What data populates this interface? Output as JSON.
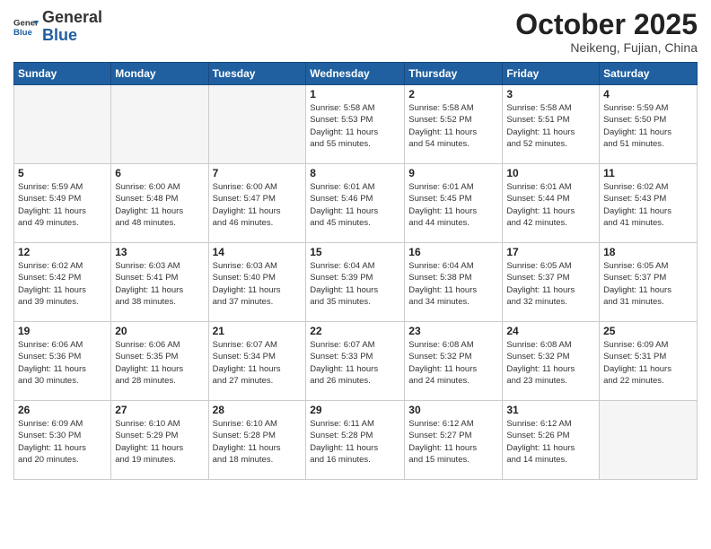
{
  "header": {
    "logo_general": "General",
    "logo_blue": "Blue",
    "month_title": "October 2025",
    "location": "Neikeng, Fujian, China"
  },
  "days_of_week": [
    "Sunday",
    "Monday",
    "Tuesday",
    "Wednesday",
    "Thursday",
    "Friday",
    "Saturday"
  ],
  "weeks": [
    [
      {
        "num": "",
        "info": ""
      },
      {
        "num": "",
        "info": ""
      },
      {
        "num": "",
        "info": ""
      },
      {
        "num": "1",
        "info": "Sunrise: 5:58 AM\nSunset: 5:53 PM\nDaylight: 11 hours\nand 55 minutes."
      },
      {
        "num": "2",
        "info": "Sunrise: 5:58 AM\nSunset: 5:52 PM\nDaylight: 11 hours\nand 54 minutes."
      },
      {
        "num": "3",
        "info": "Sunrise: 5:58 AM\nSunset: 5:51 PM\nDaylight: 11 hours\nand 52 minutes."
      },
      {
        "num": "4",
        "info": "Sunrise: 5:59 AM\nSunset: 5:50 PM\nDaylight: 11 hours\nand 51 minutes."
      }
    ],
    [
      {
        "num": "5",
        "info": "Sunrise: 5:59 AM\nSunset: 5:49 PM\nDaylight: 11 hours\nand 49 minutes."
      },
      {
        "num": "6",
        "info": "Sunrise: 6:00 AM\nSunset: 5:48 PM\nDaylight: 11 hours\nand 48 minutes."
      },
      {
        "num": "7",
        "info": "Sunrise: 6:00 AM\nSunset: 5:47 PM\nDaylight: 11 hours\nand 46 minutes."
      },
      {
        "num": "8",
        "info": "Sunrise: 6:01 AM\nSunset: 5:46 PM\nDaylight: 11 hours\nand 45 minutes."
      },
      {
        "num": "9",
        "info": "Sunrise: 6:01 AM\nSunset: 5:45 PM\nDaylight: 11 hours\nand 44 minutes."
      },
      {
        "num": "10",
        "info": "Sunrise: 6:01 AM\nSunset: 5:44 PM\nDaylight: 11 hours\nand 42 minutes."
      },
      {
        "num": "11",
        "info": "Sunrise: 6:02 AM\nSunset: 5:43 PM\nDaylight: 11 hours\nand 41 minutes."
      }
    ],
    [
      {
        "num": "12",
        "info": "Sunrise: 6:02 AM\nSunset: 5:42 PM\nDaylight: 11 hours\nand 39 minutes."
      },
      {
        "num": "13",
        "info": "Sunrise: 6:03 AM\nSunset: 5:41 PM\nDaylight: 11 hours\nand 38 minutes."
      },
      {
        "num": "14",
        "info": "Sunrise: 6:03 AM\nSunset: 5:40 PM\nDaylight: 11 hours\nand 37 minutes."
      },
      {
        "num": "15",
        "info": "Sunrise: 6:04 AM\nSunset: 5:39 PM\nDaylight: 11 hours\nand 35 minutes."
      },
      {
        "num": "16",
        "info": "Sunrise: 6:04 AM\nSunset: 5:38 PM\nDaylight: 11 hours\nand 34 minutes."
      },
      {
        "num": "17",
        "info": "Sunrise: 6:05 AM\nSunset: 5:37 PM\nDaylight: 11 hours\nand 32 minutes."
      },
      {
        "num": "18",
        "info": "Sunrise: 6:05 AM\nSunset: 5:37 PM\nDaylight: 11 hours\nand 31 minutes."
      }
    ],
    [
      {
        "num": "19",
        "info": "Sunrise: 6:06 AM\nSunset: 5:36 PM\nDaylight: 11 hours\nand 30 minutes."
      },
      {
        "num": "20",
        "info": "Sunrise: 6:06 AM\nSunset: 5:35 PM\nDaylight: 11 hours\nand 28 minutes."
      },
      {
        "num": "21",
        "info": "Sunrise: 6:07 AM\nSunset: 5:34 PM\nDaylight: 11 hours\nand 27 minutes."
      },
      {
        "num": "22",
        "info": "Sunrise: 6:07 AM\nSunset: 5:33 PM\nDaylight: 11 hours\nand 26 minutes."
      },
      {
        "num": "23",
        "info": "Sunrise: 6:08 AM\nSunset: 5:32 PM\nDaylight: 11 hours\nand 24 minutes."
      },
      {
        "num": "24",
        "info": "Sunrise: 6:08 AM\nSunset: 5:32 PM\nDaylight: 11 hours\nand 23 minutes."
      },
      {
        "num": "25",
        "info": "Sunrise: 6:09 AM\nSunset: 5:31 PM\nDaylight: 11 hours\nand 22 minutes."
      }
    ],
    [
      {
        "num": "26",
        "info": "Sunrise: 6:09 AM\nSunset: 5:30 PM\nDaylight: 11 hours\nand 20 minutes."
      },
      {
        "num": "27",
        "info": "Sunrise: 6:10 AM\nSunset: 5:29 PM\nDaylight: 11 hours\nand 19 minutes."
      },
      {
        "num": "28",
        "info": "Sunrise: 6:10 AM\nSunset: 5:28 PM\nDaylight: 11 hours\nand 18 minutes."
      },
      {
        "num": "29",
        "info": "Sunrise: 6:11 AM\nSunset: 5:28 PM\nDaylight: 11 hours\nand 16 minutes."
      },
      {
        "num": "30",
        "info": "Sunrise: 6:12 AM\nSunset: 5:27 PM\nDaylight: 11 hours\nand 15 minutes."
      },
      {
        "num": "31",
        "info": "Sunrise: 6:12 AM\nSunset: 5:26 PM\nDaylight: 11 hours\nand 14 minutes."
      },
      {
        "num": "",
        "info": ""
      }
    ]
  ]
}
